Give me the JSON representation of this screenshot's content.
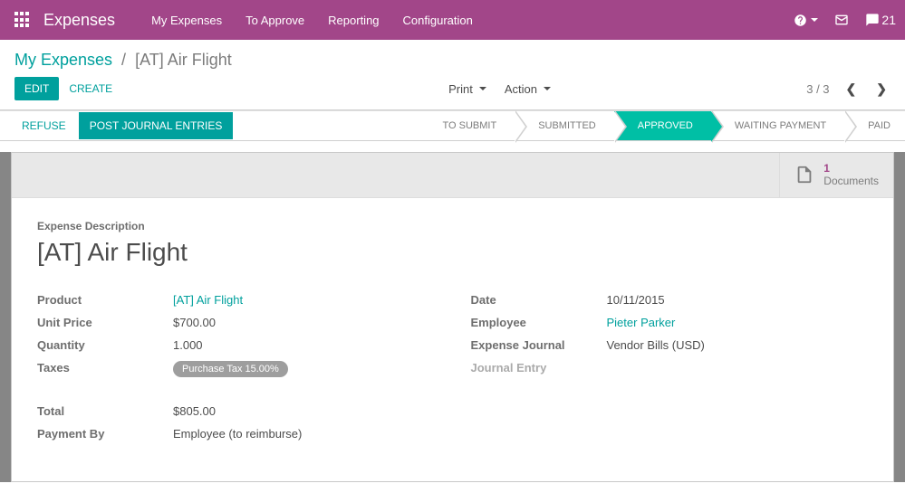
{
  "topnav": {
    "app_title": "Expenses",
    "links": [
      "My Expenses",
      "To Approve",
      "Reporting",
      "Configuration"
    ],
    "msg_count": "21"
  },
  "breadcrumb": {
    "parent": "My Expenses",
    "sep": "/",
    "current": "[AT] Air Flight"
  },
  "buttons": {
    "edit": "EDIT",
    "create": "CREATE",
    "print": "Print",
    "action": "Action",
    "refuse": "REFUSE",
    "post": "POST JOURNAL ENTRIES"
  },
  "pager": {
    "text": "3 / 3"
  },
  "status": {
    "steps": [
      "TO SUBMIT",
      "SUBMITTED",
      "APPROVED",
      "WAITING PAYMENT",
      "PAID"
    ],
    "active_index": 2
  },
  "stat": {
    "count": "1",
    "label": "Documents"
  },
  "desc_label": "Expense Description",
  "title": "[AT] Air Flight",
  "fields_left": {
    "product": {
      "label": "Product",
      "value": "[AT] Air Flight"
    },
    "unit_price": {
      "label": "Unit Price",
      "value": "$700.00"
    },
    "quantity": {
      "label": "Quantity",
      "value": "1.000"
    },
    "taxes": {
      "label": "Taxes",
      "value": "Purchase Tax 15.00%"
    },
    "total": {
      "label": "Total",
      "value": "$805.00"
    },
    "payment_by": {
      "label": "Payment By",
      "value": "Employee (to reimburse)"
    }
  },
  "fields_right": {
    "date": {
      "label": "Date",
      "value": "10/11/2015"
    },
    "employee": {
      "label": "Employee",
      "value": "Pieter Parker"
    },
    "journal": {
      "label": "Expense Journal",
      "value": "Vendor Bills (USD)"
    },
    "entry": {
      "label": "Journal Entry",
      "value": ""
    }
  }
}
